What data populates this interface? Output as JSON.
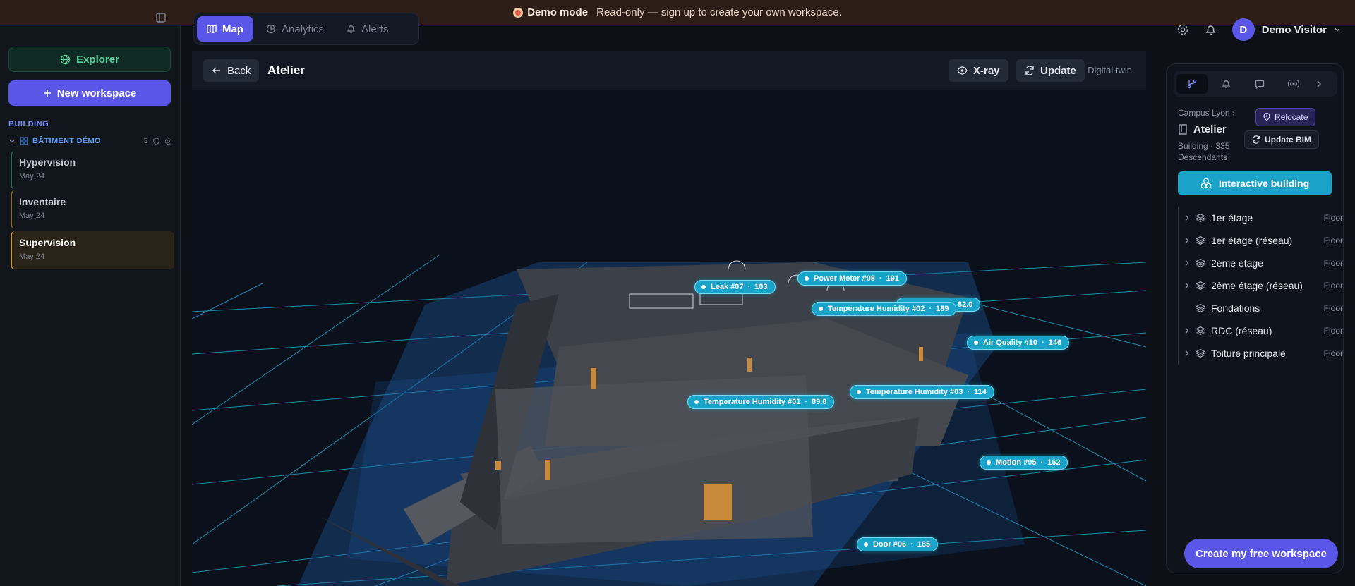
{
  "banner": {
    "title": "Demo mode",
    "message": "Read-only — sign up to create your own workspace."
  },
  "sidebar": {
    "explorer_label": "Explorer",
    "new_workspace_label": "New workspace",
    "section_label": "BUILDING",
    "tree_root": {
      "label": "BÂTIMENT DÉMO",
      "count": "3"
    },
    "workspaces": [
      {
        "title": "Hypervision",
        "date": "May 24",
        "accent": "#2b6b57"
      },
      {
        "title": "Inventaire",
        "date": "May 24",
        "accent": "#8a6a2a"
      },
      {
        "title": "Supervision",
        "date": "May 24",
        "accent": "#c89a3a"
      }
    ]
  },
  "nav": {
    "tabs": [
      {
        "label": "Map",
        "active": true
      },
      {
        "label": "Analytics"
      },
      {
        "label": "Alerts"
      }
    ]
  },
  "user": {
    "initial": "D",
    "name": "Demo Visitor"
  },
  "viewport": {
    "back_label": "Back",
    "title": "Atelier",
    "xray_label": "X-ray",
    "update_label": "Update",
    "mode_label": "Digital twin",
    "sensors": [
      {
        "name": "Leak #07",
        "value": "103"
      },
      {
        "name": "Power Meter #08",
        "value": "191"
      },
      {
        "name": "",
        "value": "82.0"
      },
      {
        "name": "Temperature Humidity #02",
        "value": "189"
      },
      {
        "name": "Air Quality #10",
        "value": "146"
      },
      {
        "name": "Temperature Humidity #03",
        "value": "114"
      },
      {
        "name": "Temperature Humidity #01",
        "value": "89.0"
      },
      {
        "name": "Motion #05",
        "value": "162"
      },
      {
        "name": "Door #06",
        "value": "185"
      }
    ]
  },
  "panel": {
    "breadcrumb": "Campus Lyon",
    "relocate_label": "Relocate",
    "building_name": "Atelier",
    "update_bim_label": "Update BIM",
    "meta": "Building · 335 Descendants",
    "interactive_label": "Interactive building",
    "floors": [
      {
        "name": "1er étage",
        "type": "Floor",
        "expandable": true
      },
      {
        "name": "1er étage (réseau)",
        "type": "Floor",
        "expandable": true
      },
      {
        "name": "2ème étage",
        "type": "Floor",
        "expandable": true
      },
      {
        "name": "2ème étage (réseau)",
        "type": "Floor",
        "expandable": true
      },
      {
        "name": "Fondations",
        "type": "Floor",
        "expandable": false
      },
      {
        "name": "RDC (réseau)",
        "type": "Floor",
        "expandable": true
      },
      {
        "name": "Toiture principale",
        "type": "Floor",
        "expandable": true
      }
    ]
  },
  "cta_label": "Create my free workspace",
  "colors": {
    "accent": "#5a56e8",
    "sensor": "#1aa3c9",
    "explorer": "#58d3a0"
  }
}
